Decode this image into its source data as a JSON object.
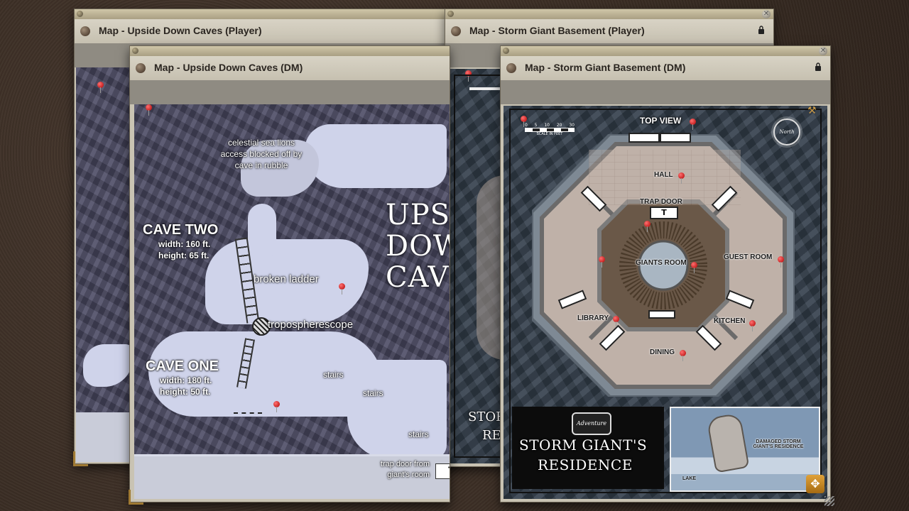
{
  "windows": {
    "upside_player": {
      "title": "Map - Upside Down Caves (Player)"
    },
    "upside_dm": {
      "title": "Map - Upside Down Caves (DM)"
    },
    "storm_player": {
      "title": "Map - Storm Giant Basement (Player)"
    },
    "storm_dm": {
      "title": "Map - Storm Giant Basement (DM)"
    }
  },
  "upside_map": {
    "title_art": "UPSIDE DOWN CAVES",
    "note_sea_lions": "celestial sea lions access blocked off by cave in rubble",
    "cave_two": {
      "name": "CAVE TWO",
      "width": "width: 160 ft.",
      "height": "height: 65 ft."
    },
    "cave_one": {
      "name": "CAVE ONE",
      "width": "width: 180 ft.",
      "height": "height: 50 ft."
    },
    "broken_ladder": "broken ladder",
    "troposcope": "tropospherescope",
    "stairs": [
      "stairs",
      "stairs",
      "stairs"
    ],
    "trap_door_note": "trap door from giant's room",
    "trap_marker": "T"
  },
  "storm_map": {
    "top_view": "TOP VIEW",
    "scale": [
      "0",
      "5",
      "10",
      "20",
      "30"
    ],
    "scale_caption": "SCALE IN FEET",
    "north": "North",
    "rooms": {
      "hall": "HALL",
      "trap_door": "TRAP DOOR",
      "giants_room": "GIANTS ROOM",
      "guest_room": "GUEST ROOM",
      "library": "LIBRARY",
      "kitchen": "KITCHEN",
      "dining": "DINING"
    },
    "trap_marker": "T",
    "logo": "Adventure",
    "residence_title_1": "STORM GIANT'S",
    "residence_title_2": "RESIDENCE",
    "inset_caption": "DAMAGED STORM GIANT'S RESIDENCE",
    "inset_lake": "LAKE",
    "player_title_1": "STOR",
    "player_title_2": "RE"
  }
}
